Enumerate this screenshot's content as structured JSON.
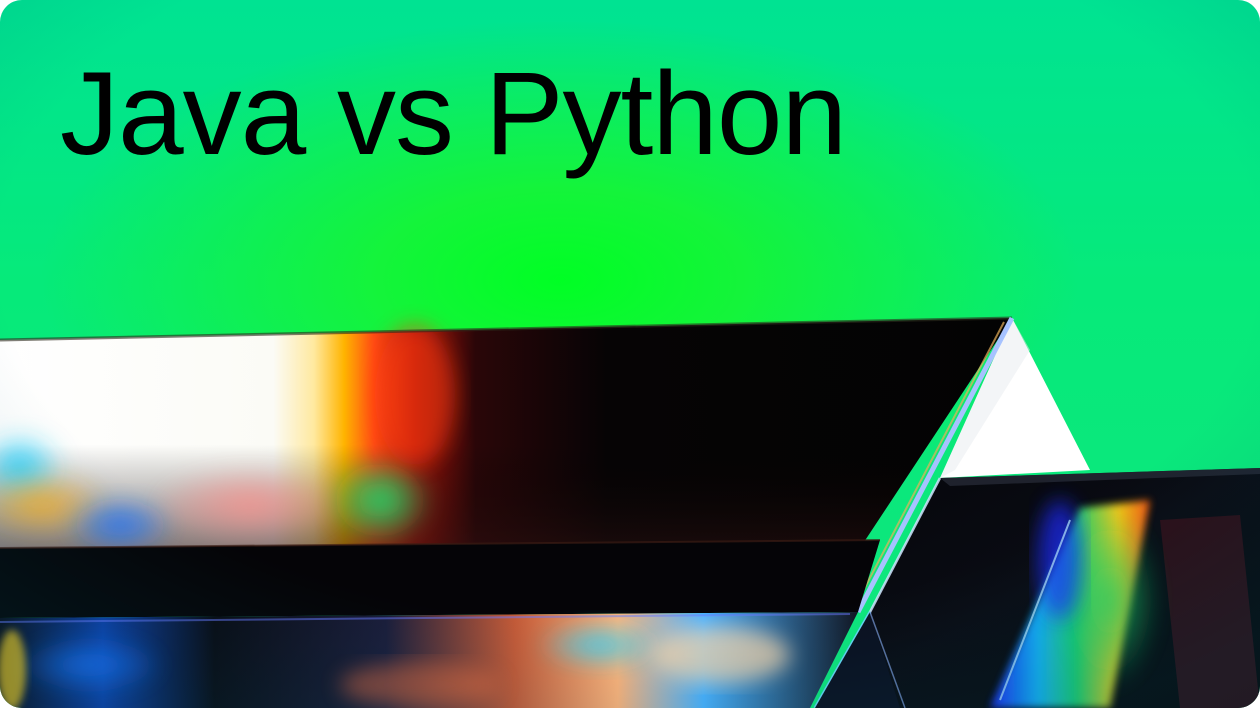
{
  "hero": {
    "title": "Java vs Python"
  },
  "palette": {
    "background_top": "#00e392",
    "background_glow": "#00ff24",
    "prism_dark": "#050405",
    "spectrum": [
      "#ff2a10",
      "#ff8a00",
      "#ffd21a",
      "#18d870",
      "#19b8ff",
      "#2d4dff"
    ]
  },
  "image": {
    "subject": "glass-prism-spectrum"
  }
}
